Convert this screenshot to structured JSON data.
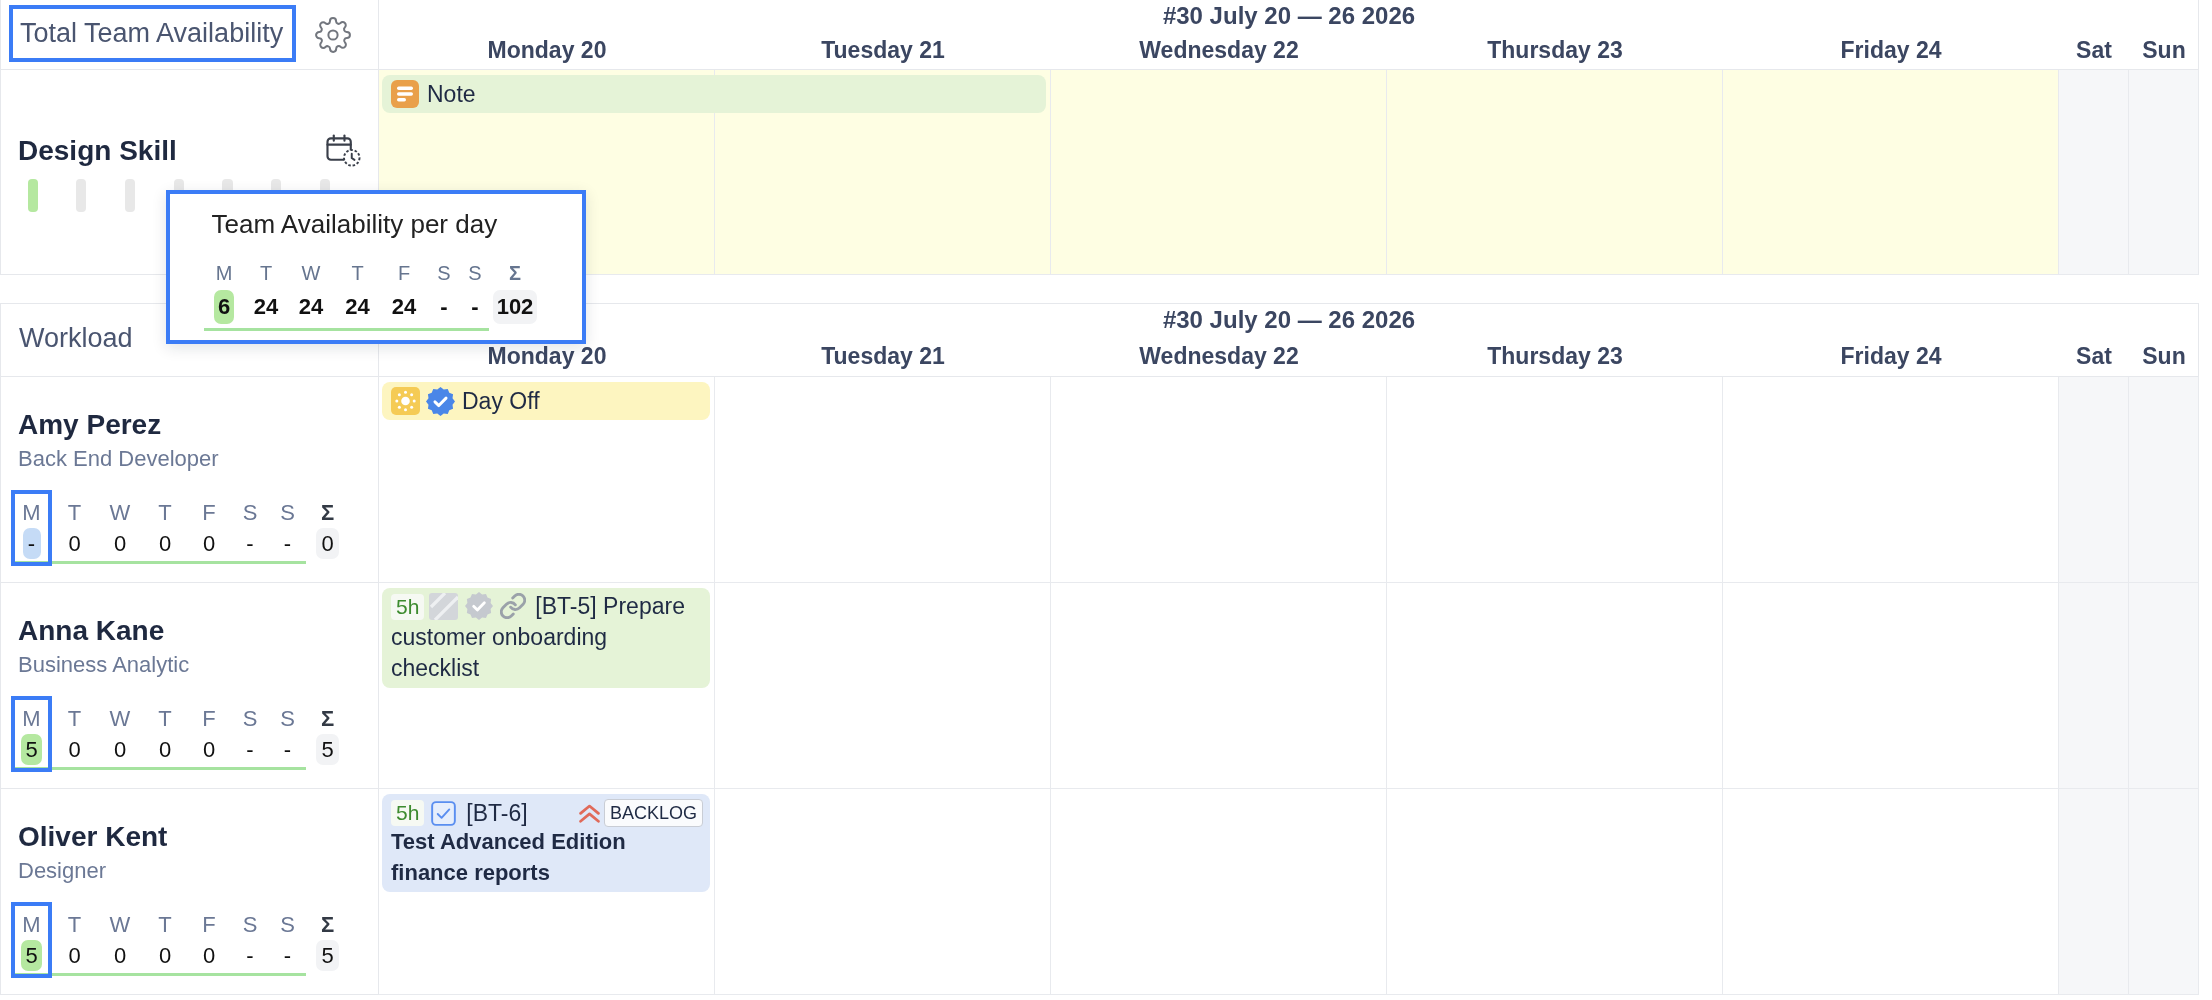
{
  "summary": {
    "title": "Total Team Availability",
    "highlighted": true
  },
  "top_calendar": {
    "week_label": "#30 July 20 — 26 2026",
    "days": [
      {
        "label": "Monday 20",
        "weekend": false
      },
      {
        "label": "Tuesday 21",
        "weekend": false
      },
      {
        "label": "Wednesday 22",
        "weekend": false
      },
      {
        "label": "Thursday 23",
        "weekend": false
      },
      {
        "label": "Friday 24",
        "weekend": false
      },
      {
        "label": "Sat",
        "weekend": true
      },
      {
        "label": "Sun",
        "weekend": true
      }
    ]
  },
  "skill": {
    "name": "Design Skill",
    "day_bars": [
      {
        "color": "#b5e8a0"
      },
      {
        "color": "#e8e8e8"
      },
      {
        "color": "#e8e8e8"
      },
      {
        "color": "#e8e8e8"
      },
      {
        "color": "#e8e8e8"
      },
      {
        "color": "#e8e8e8"
      },
      {
        "color": "#e8e8e8"
      }
    ],
    "cells": [
      {
        "events": [
          {
            "kind": "note",
            "title": "Note",
            "color": "#e5f3d7",
            "multi_day": true
          }
        ]
      }
    ]
  },
  "availability_popup": {
    "title": "Team Availability per day",
    "highlighted": true,
    "days": [
      {
        "letter": "M",
        "value": "6",
        "color": "#b5e8a0"
      },
      {
        "letter": "T",
        "value": "24"
      },
      {
        "letter": "W",
        "value": "24"
      },
      {
        "letter": "T",
        "value": "24"
      },
      {
        "letter": "F",
        "value": "24"
      },
      {
        "letter": "S",
        "value": "-"
      },
      {
        "letter": "S",
        "value": "-"
      }
    ],
    "total": {
      "letter": "Σ",
      "value": "102"
    }
  },
  "workload": {
    "title": "Workload",
    "week_label": "#30 July 20 — 26 2026",
    "days": [
      {
        "label": "Monday 20"
      },
      {
        "label": "Tuesday 21"
      },
      {
        "label": "Wednesday 22"
      },
      {
        "label": "Thursday 23"
      },
      {
        "label": "Friday 24"
      },
      {
        "label": "Sat"
      },
      {
        "label": "Sun"
      }
    ],
    "people": [
      {
        "name": "Amy Perez",
        "role": "Back End Developer",
        "days": [
          {
            "letter": "M",
            "value": "-",
            "color": "#c5dbf6",
            "highlighted": true
          },
          {
            "letter": "T",
            "value": "0",
            "highlighted": false
          },
          {
            "letter": "W",
            "value": "0",
            "highlighted": false
          },
          {
            "letter": "T",
            "value": "0",
            "highlighted": false
          },
          {
            "letter": "F",
            "value": "0",
            "highlighted": false
          },
          {
            "letter": "S",
            "value": "-",
            "highlighted": false
          },
          {
            "letter": "S",
            "value": "-",
            "highlighted": false
          }
        ],
        "total": {
          "letter": "Σ",
          "value": "0"
        },
        "cells": [
          {
            "events": [
              {
                "kind": "day_off",
                "title": "Day Off",
                "color": "#fdf5c0",
                "multi_day": false
              }
            ]
          }
        ]
      },
      {
        "name": "Anna Kane",
        "role": "Business Analytic",
        "days": [
          {
            "letter": "M",
            "value": "5",
            "color": "#b5e8a0",
            "highlighted": true
          },
          {
            "letter": "T",
            "value": "0",
            "highlighted": false
          },
          {
            "letter": "W",
            "value": "0",
            "highlighted": false
          },
          {
            "letter": "T",
            "value": "0",
            "highlighted": false
          },
          {
            "letter": "F",
            "value": "0",
            "highlighted": false
          },
          {
            "letter": "S",
            "value": "-",
            "highlighted": false
          },
          {
            "letter": "S",
            "value": "-",
            "highlighted": false
          }
        ],
        "total": {
          "letter": "Σ",
          "value": "5"
        },
        "cells": [
          {
            "events": [
              {
                "kind": "linked",
                "hours": "5h",
                "title": "[BT-5] Prepare customer onboarding checklist",
                "color": "#e5f3d7",
                "multi_day": false,
                "high_priority": false
              }
            ]
          }
        ]
      },
      {
        "name": "Oliver Kent",
        "role": "Designer",
        "days": [
          {
            "letter": "M",
            "value": "5",
            "color": "#b5e8a0",
            "highlighted": true
          },
          {
            "letter": "T",
            "value": "0",
            "highlighted": false
          },
          {
            "letter": "W",
            "value": "0",
            "highlighted": false
          },
          {
            "letter": "T",
            "value": "0",
            "highlighted": false
          },
          {
            "letter": "F",
            "value": "0",
            "highlighted": false
          },
          {
            "letter": "S",
            "value": "-",
            "highlighted": false
          },
          {
            "letter": "S",
            "value": "-",
            "highlighted": false
          }
        ],
        "total": {
          "letter": "Σ",
          "value": "5"
        },
        "cells": [
          {
            "events": [
              {
                "kind": "task",
                "hours": "5h",
                "key": "[BT-6]",
                "title": "Test Advanced Edition finance reports",
                "status": "BACKLOG",
                "color": "#dfe8f8",
                "multi_day": false,
                "high_priority": true
              }
            ]
          }
        ]
      }
    ]
  }
}
